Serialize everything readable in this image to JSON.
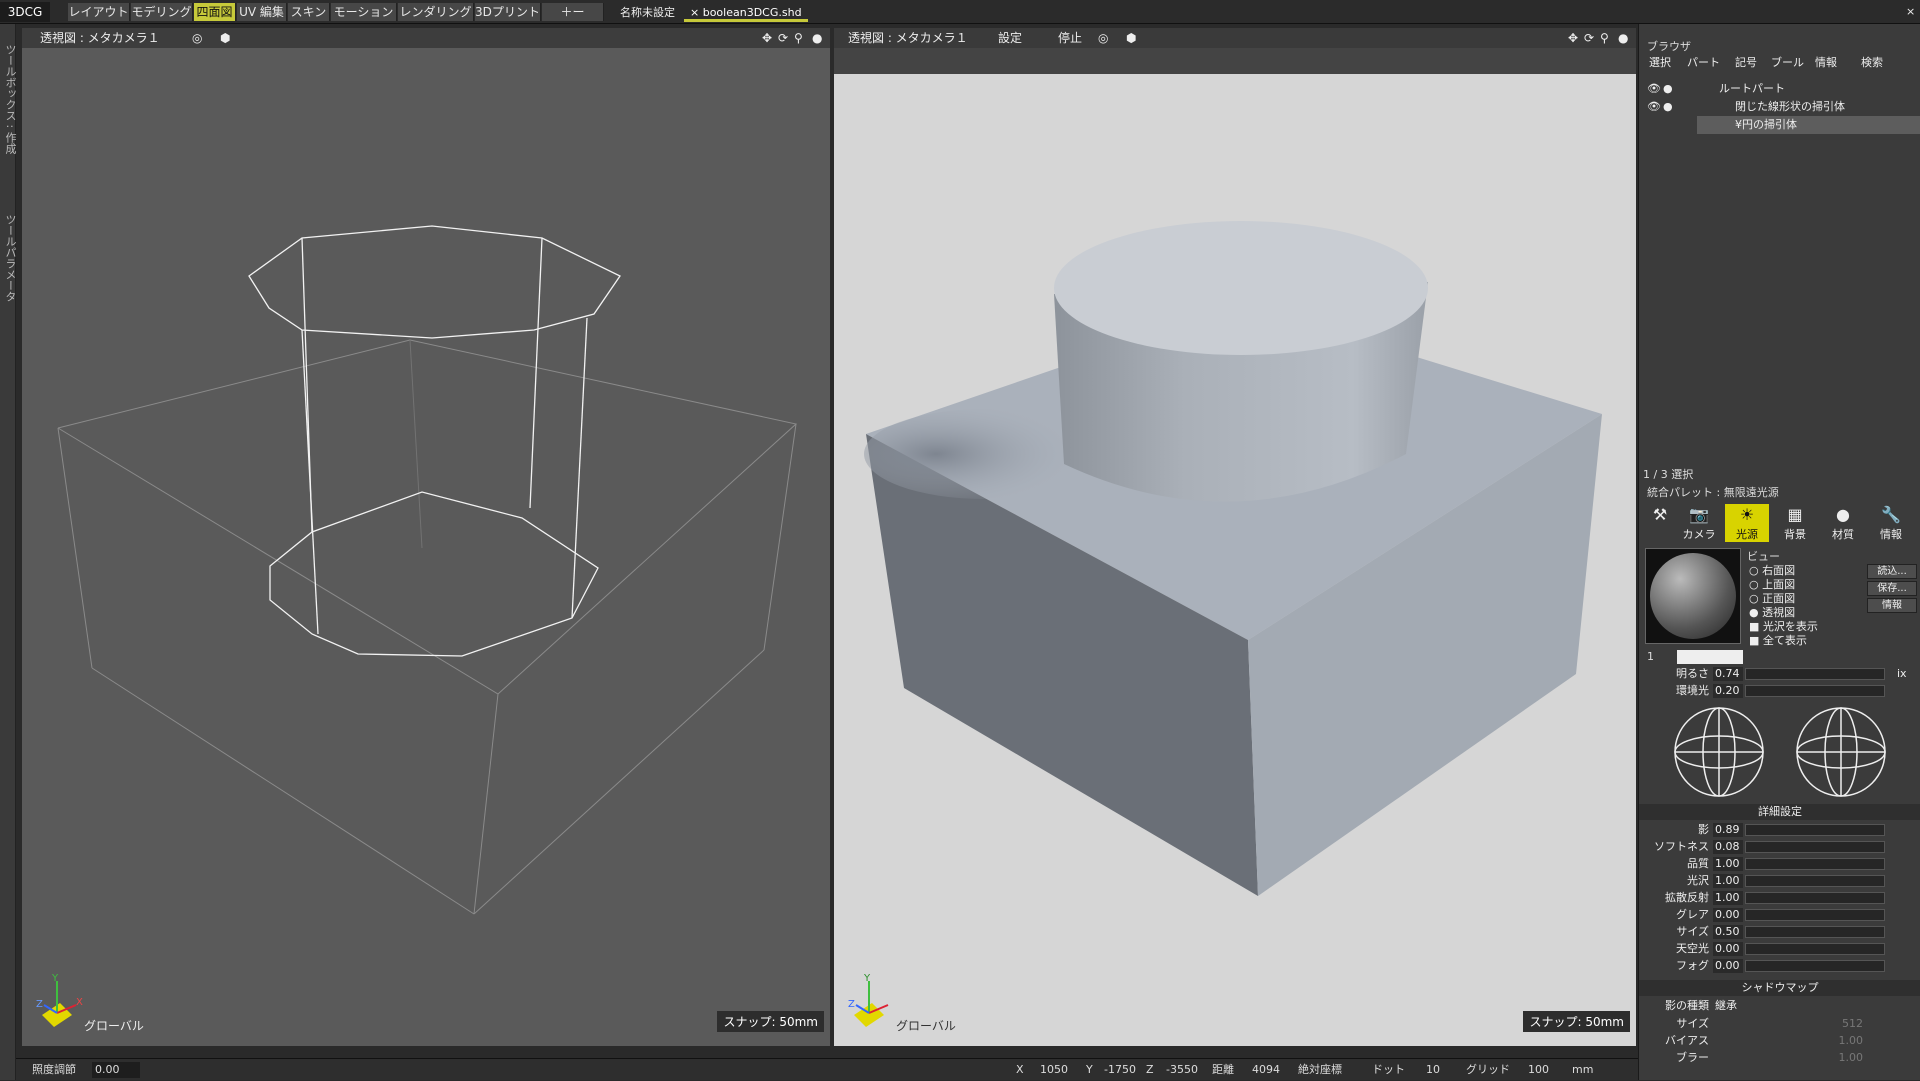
{
  "topbar": {
    "app": "3DCG",
    "tabs": [
      "レイアウト",
      "モデリング",
      "四面図",
      "UV 編集",
      "スキン",
      "モーション",
      "レンダリング",
      "3Dプリント",
      "＋ー"
    ],
    "active_tab": "四面図",
    "doc_tabs": [
      "名称未設定",
      "× boolean3DCG.shd"
    ],
    "close": "×"
  },
  "leftstrip": {
    "label1": "ツールボックス : 作成",
    "label2": "ツールパラメータ"
  },
  "viewport_left": {
    "title": "透視図 : メタカメラ１",
    "snap": "スナップ: 50mm",
    "axis_label": "グローバル",
    "axes": [
      "Y",
      "Z",
      "X"
    ]
  },
  "viewport_right": {
    "title": "透視図 : メタカメラ１",
    "settings": "設定",
    "stop": "停止",
    "snap": "スナップ: 50mm",
    "axis_label": "グローバル",
    "axes": [
      "Y",
      "Z"
    ]
  },
  "statusbar": {
    "label": "照度調節",
    "value": "0.00",
    "x_label": "X",
    "x": "1050",
    "y_label": "Y",
    "y": "-1750",
    "z_label": "Z",
    "z": "-3550",
    "dist_label": "距離",
    "dist": "4094",
    "abs_label": "絶対座標",
    "dot_label": "ドット",
    "dot": "10",
    "grid_label": "グリッド",
    "grid": "100",
    "unit": "mm"
  },
  "browser": {
    "title": "ブラウザ",
    "tabs": [
      "選択",
      "パート",
      "記号",
      "ブール",
      "情報",
      "検索"
    ],
    "tree": [
      "ルートパート",
      "閉じた線形状の掃引体",
      "¥円の掃引体"
    ],
    "selection": "1 / 3 選択"
  },
  "palette": {
    "title": "統合パレット : 無限遠光源",
    "icons": [
      "カメラ",
      "光源",
      "背景",
      "材質",
      "情報"
    ],
    "active_icon": "光源",
    "view_label": "ビュー",
    "views": [
      "右面図",
      "上面図",
      "正面図",
      "透視図",
      "光沢を表示",
      "全て表示"
    ],
    "buttons": [
      "読込...",
      "保存...",
      "情報"
    ],
    "light_index": "1",
    "brightness_label": "明るさ",
    "brightness": "0.74",
    "ix": "ix",
    "ambient_label": "環境光",
    "ambient": "0.20",
    "detail_header": "詳細設定",
    "details": [
      {
        "label": "影",
        "value": "0.89"
      },
      {
        "label": "ソフトネス",
        "value": "0.08"
      },
      {
        "label": "品質",
        "value": "1.00"
      },
      {
        "label": "光沢",
        "value": "1.00"
      },
      {
        "label": "拡散反射",
        "value": "1.00"
      },
      {
        "label": "グレア",
        "value": "0.00"
      },
      {
        "label": "サイズ",
        "value": "0.50"
      },
      {
        "label": "天空光",
        "value": "0.00"
      },
      {
        "label": "フォグ",
        "value": "0.00"
      }
    ],
    "shadowmap_header": "シャドウマップ",
    "shadow_type_label": "影の種類",
    "shadow_type": "継承",
    "shadow": [
      {
        "label": "サイズ",
        "value": "512"
      },
      {
        "label": "バイアス",
        "value": "1.00"
      },
      {
        "label": "ブラー",
        "value": "1.00"
      }
    ]
  },
  "colors": {
    "accent": "#c6c93a",
    "active_icon_bg": "#d8d300"
  }
}
